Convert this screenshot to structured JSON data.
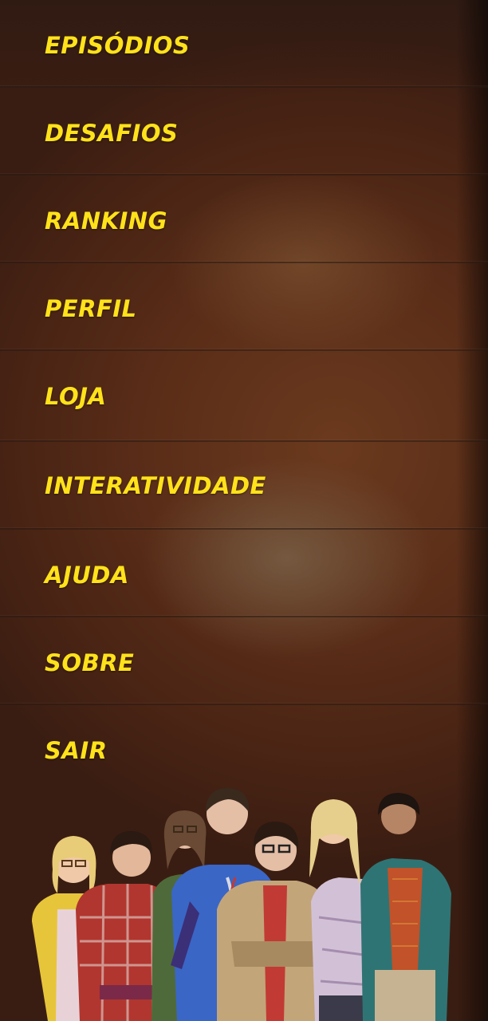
{
  "menu": {
    "items": [
      {
        "label": "EPISÓDIOS"
      },
      {
        "label": "DESAFIOS"
      },
      {
        "label": "RANKING"
      },
      {
        "label": "PERFIL"
      },
      {
        "label": "LOJA"
      },
      {
        "label": "INTERATIVIDADE"
      },
      {
        "label": "AJUDA"
      },
      {
        "label": "SOBRE"
      },
      {
        "label": "SAIR"
      }
    ]
  },
  "colors": {
    "label": "#ffe21a",
    "background": "#4a2414",
    "divider": "#2a1912"
  }
}
